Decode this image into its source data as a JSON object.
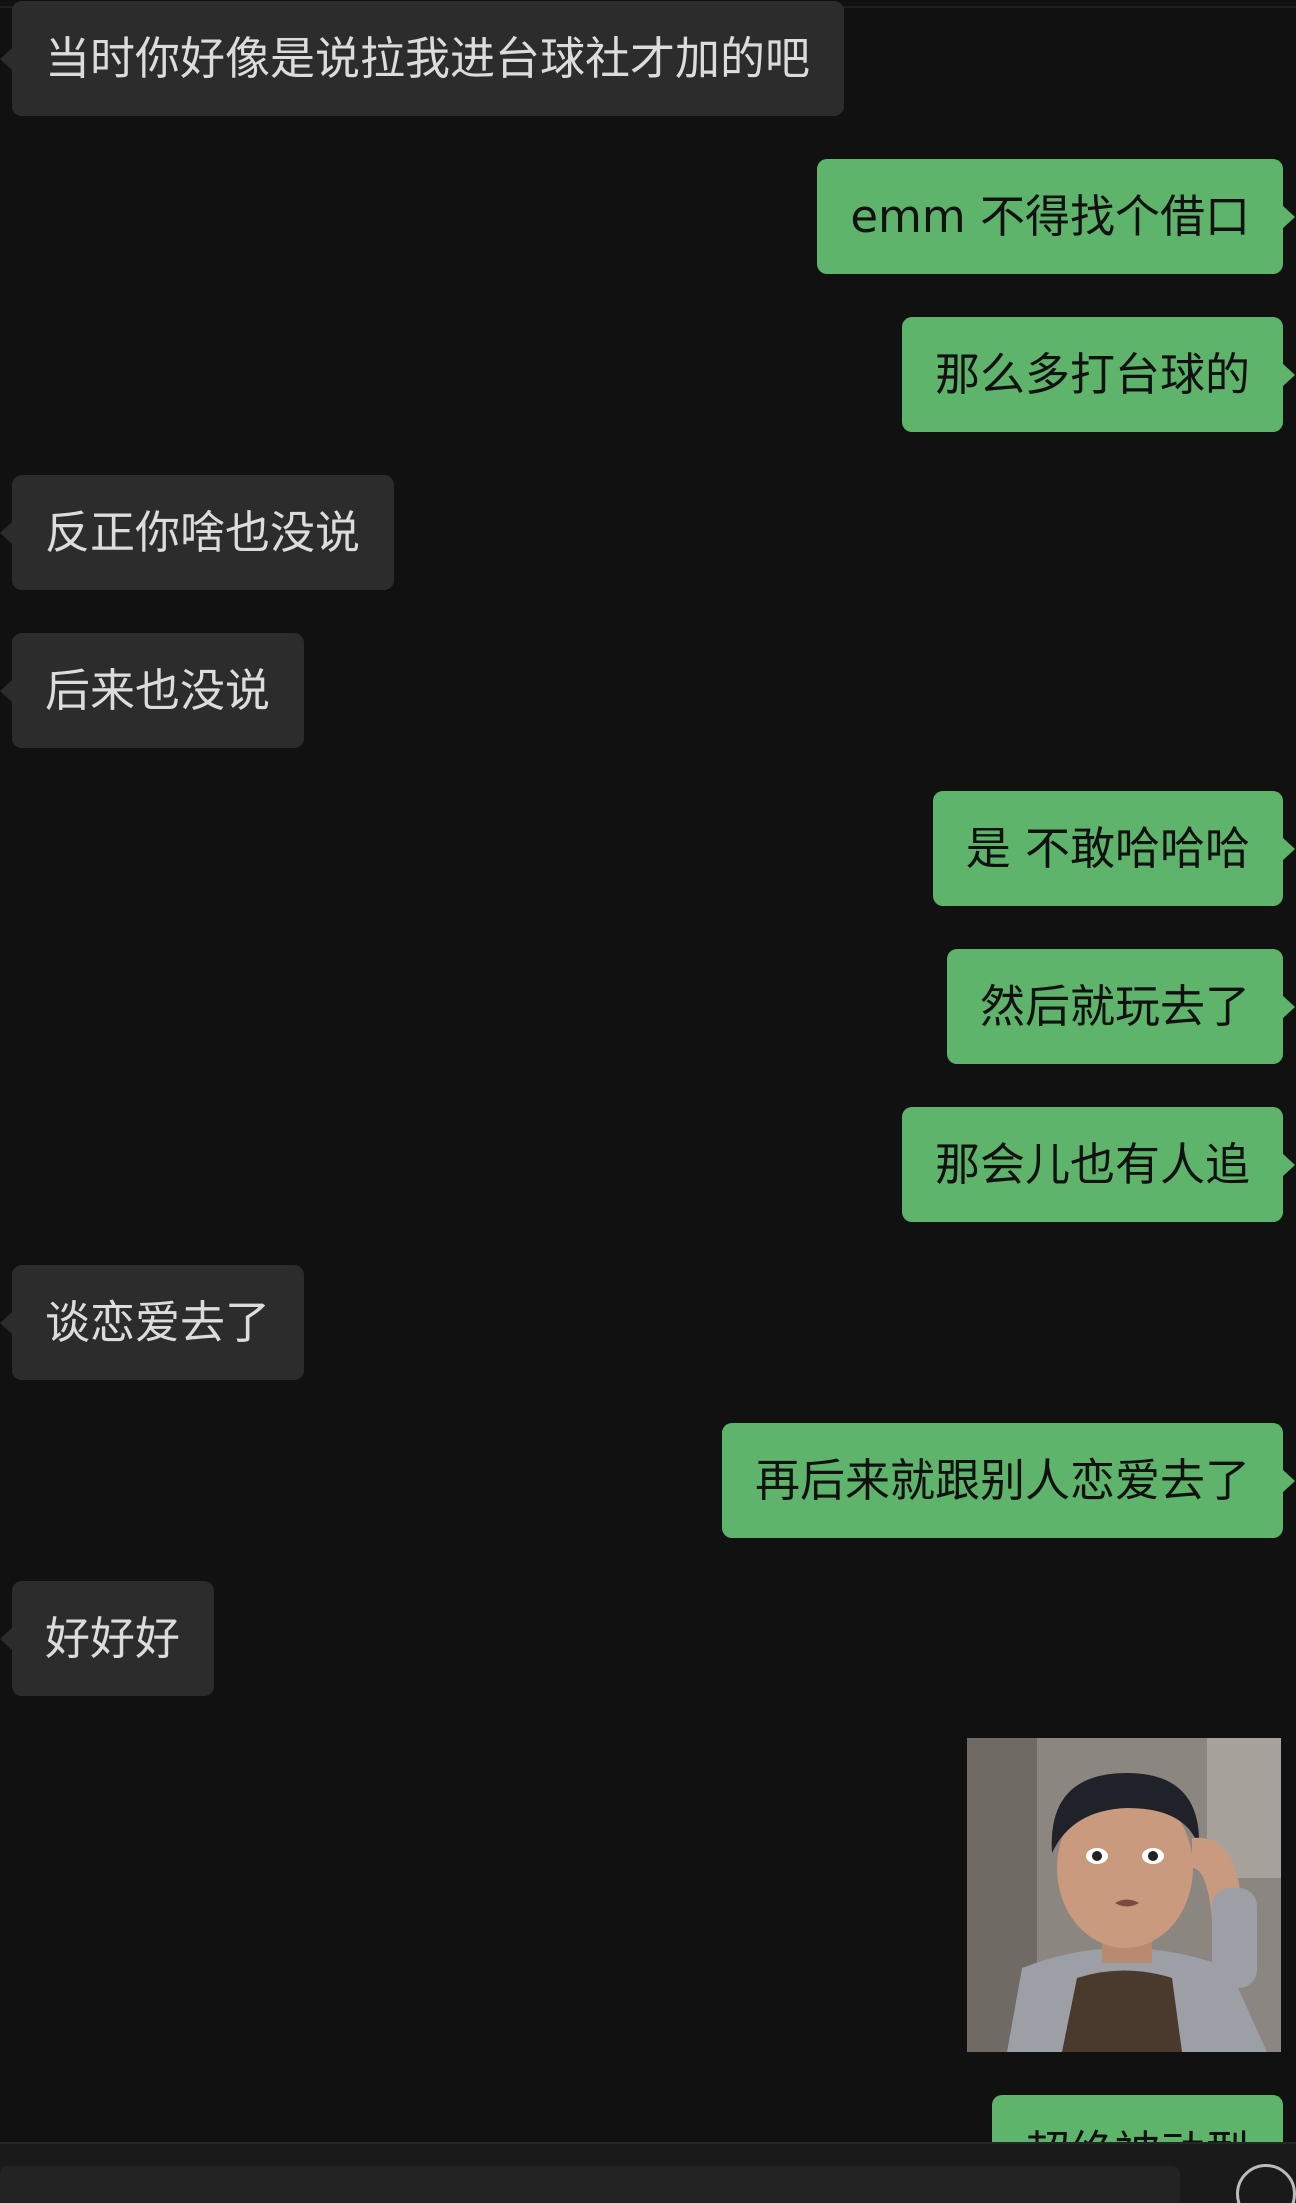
{
  "messages": [
    {
      "side": "left",
      "text": "当时你好像是说拉我进台球社才加的吧"
    },
    {
      "side": "right",
      "text": "emm 不得找个借口"
    },
    {
      "side": "right",
      "text": "那么多打台球的"
    },
    {
      "side": "left",
      "text": "反正你啥也没说"
    },
    {
      "side": "left",
      "text": "后来也没说"
    },
    {
      "side": "right",
      "text": "是 不敢哈哈哈"
    },
    {
      "side": "right",
      "text": "然后就玩去了"
    },
    {
      "side": "right",
      "text": "那会儿也有人追"
    },
    {
      "side": "left",
      "text": "谈恋爱去了"
    },
    {
      "side": "right",
      "text": "再后来就跟别人恋爱去了"
    },
    {
      "side": "left",
      "text": "好好好"
    },
    {
      "side": "right",
      "text": "超绝被动型"
    }
  ],
  "sticker": {
    "icon": "meme-face-sticker",
    "colors": {
      "background": "#8b8680",
      "hair": "#1f2228",
      "skin": "#c99a7e",
      "shirt": "#4a3a2e",
      "sleeve": "#9c9fa6"
    }
  },
  "colors": {
    "background": "#111111",
    "incoming_bubble": "#2c2c2c",
    "outgoing_bubble": "#5eb46a",
    "incoming_text": "#dcdcdc",
    "outgoing_text": "#111111"
  }
}
